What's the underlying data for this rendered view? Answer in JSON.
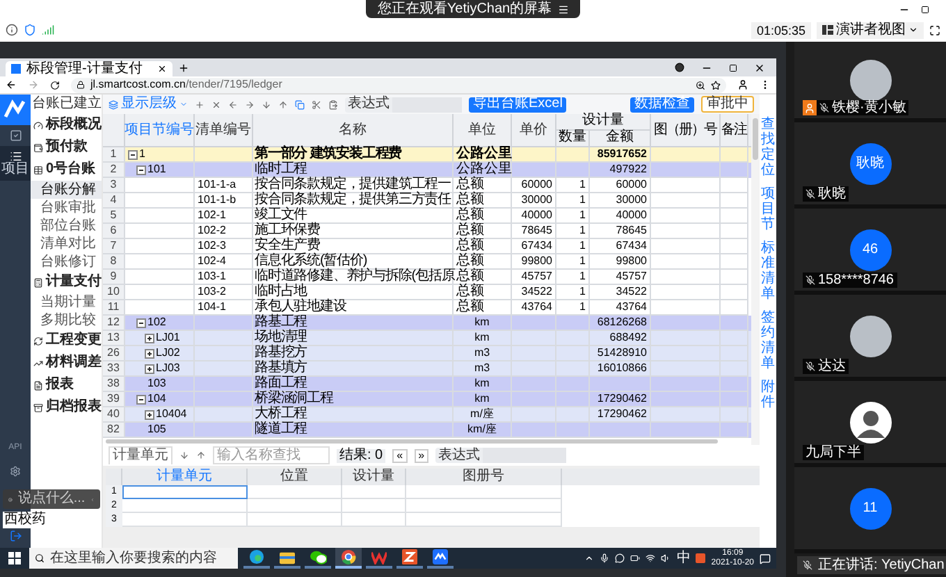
{
  "meeting": {
    "banner": "您正在观看YetiyChan的屏幕",
    "timer": "01:05:35",
    "view_button": "演讲者视图"
  },
  "browser": {
    "tab_title": "标段管理-计量支付",
    "url_host": "jl.smartcost.com.cn",
    "url_path": "/tender/7195/ledger"
  },
  "rail": {
    "items": [
      {
        "selected": false
      },
      {
        "label": "项目",
        "selected": true
      }
    ],
    "footer": "API",
    "tooltip": "西校药"
  },
  "chat": {
    "placeholder": "说点什么..."
  },
  "sidebar": {
    "status": "台账已建立",
    "groups": [
      {
        "label": "标段概况"
      },
      {
        "label": "预付款"
      },
      {
        "label": "0号台账",
        "items": [
          {
            "label": "台账分解",
            "selected": true
          },
          {
            "label": "台账审批",
            "selected": false
          },
          {
            "label": "部位台账",
            "selected": false
          },
          {
            "label": "清单对比",
            "selected": false
          },
          {
            "label": "台账修订",
            "selected": false
          }
        ]
      },
      {
        "label": "计量支付",
        "items": [
          {
            "label": "当期计量",
            "selected": false
          },
          {
            "label": "多期比较",
            "selected": false
          }
        ]
      },
      {
        "label": "工程变更"
      },
      {
        "label": "材料调差"
      },
      {
        "label": "报表"
      },
      {
        "label": "归档报表"
      }
    ]
  },
  "toolbar": {
    "level_button": "显示层级",
    "expression_label": "表达式",
    "export_button": "导出台账Excel",
    "check_button": "数据检查",
    "status_badge": "审批中"
  },
  "ledger": {
    "columns": [
      "项目节编号",
      "清单编号",
      "名称",
      "单位",
      "单价"
    ],
    "group": {
      "label": "设计量",
      "columns": [
        "数量",
        "金额"
      ]
    },
    "columns_after": [
      "图（册）号",
      "备注"
    ],
    "rows": [
      {
        "num": "1",
        "code": "1",
        "name": "第一部分 建筑安装工程费",
        "unit": "公路公里",
        "amount": "85917652",
        "expanded": true,
        "children": [
          {
            "num": "2",
            "code": "101",
            "name": "临时工程",
            "unit": "公路公里",
            "amount": "497922",
            "expanded": true,
            "children": [
              {
                "num": "3",
                "bill": "101-1-a",
                "name": "按合同条款规定，提供建筑工程一",
                "unit": "总额",
                "price": "60000",
                "qty": "1",
                "amount": "60000"
              },
              {
                "num": "4",
                "bill": "101-1-b",
                "name": "按合同条款规定，提供第三方责任",
                "unit": "总额",
                "price": "30000",
                "qty": "1",
                "amount": "30000"
              },
              {
                "num": "5",
                "bill": "102-1",
                "name": "竣工文件",
                "unit": "总额",
                "price": "40000",
                "qty": "1",
                "amount": "40000"
              },
              {
                "num": "6",
                "bill": "102-2",
                "name": "施工环保费",
                "unit": "总额",
                "price": "78645",
                "qty": "1",
                "amount": "78645"
              },
              {
                "num": "7",
                "bill": "102-3",
                "name": "安全生产费",
                "unit": "总额",
                "price": "67434",
                "qty": "1",
                "amount": "67434"
              },
              {
                "num": "8",
                "bill": "102-4",
                "name": "信息化系统(暂估价)",
                "unit": "总额",
                "price": "99800",
                "qty": "1",
                "amount": "99800"
              },
              {
                "num": "9",
                "bill": "103-1",
                "name": "临时道路修建、养护与拆除(包括原",
                "unit": "总额",
                "price": "45757",
                "qty": "1",
                "amount": "45757"
              },
              {
                "num": "10",
                "bill": "103-2",
                "name": "临时占地",
                "unit": "总额",
                "price": "34522",
                "qty": "1",
                "amount": "34522"
              },
              {
                "num": "11",
                "bill": "104-1",
                "name": "承包人驻地建设",
                "unit": "总额",
                "price": "43764",
                "qty": "1",
                "amount": "43764"
              }
            ]
          },
          {
            "num": "12",
            "code": "102",
            "name": "路基工程",
            "unit": "km",
            "amount": "68126268",
            "expanded": true,
            "children": [
              {
                "num": "13",
                "code": "LJ01",
                "name": "场地清理",
                "unit": "km",
                "amount": "688492",
                "expanded": false
              },
              {
                "num": "26",
                "code": "LJ02",
                "name": "路基挖方",
                "unit": "m3",
                "amount": "51428910",
                "expanded": false
              },
              {
                "num": "33",
                "code": "LJ03",
                "name": "路基填方",
                "unit": "m3",
                "amount": "16010866",
                "expanded": false
              }
            ]
          },
          {
            "num": "38",
            "code": "103",
            "name": "路面工程",
            "unit": "km"
          },
          {
            "num": "39",
            "code": "104",
            "name": "桥梁涵洞工程",
            "unit": "km",
            "amount": "17290462",
            "expanded": true,
            "children": [
              {
                "num": "40",
                "code": "10404",
                "name": "大桥工程",
                "unit": "m/座",
                "amount": "17290462",
                "expanded": false
              }
            ]
          },
          {
            "num": "82",
            "code": "105",
            "name": "隧道工程",
            "unit": "km/座"
          }
        ]
      }
    ]
  },
  "side_links": [
    "查找定位",
    "项目节",
    "标准清单",
    "签约清单",
    "附件"
  ],
  "units": {
    "tab": "计量单元",
    "search_placeholder": "输入名称查找",
    "result": "结果: 0",
    "prev": "«",
    "next": "»",
    "expression_label": "表达式",
    "columns": [
      "计量单元",
      "位置",
      "设计量",
      "图册号"
    ],
    "rows": [
      "1",
      "2",
      "3"
    ]
  },
  "taskbar": {
    "search_placeholder": "在这里输入你要搜索的内容",
    "apps": [
      {
        "kind": "edge",
        "selected": false
      },
      {
        "kind": "folder",
        "selected": false
      },
      {
        "kind": "wechat",
        "selected": false
      },
      {
        "kind": "chrome",
        "selected": true
      },
      {
        "kind": "wps",
        "selected": false
      },
      {
        "kind": "zapp",
        "selected": false
      },
      {
        "kind": "meeting",
        "selected": false
      }
    ],
    "ime": "中",
    "time": "16:09",
    "date": "2021-10-20"
  },
  "participants": [
    {
      "name": "铁樱·黄小敏",
      "kind": "photo",
      "muted": true,
      "host": true
    },
    {
      "name": "耿晓",
      "kind": "initials",
      "avatar_text": "耿晓",
      "muted": true,
      "host": false
    },
    {
      "name": "158****8746",
      "kind": "initials",
      "avatar_text": "46",
      "muted": true,
      "host": false
    },
    {
      "name": "达达",
      "kind": "photo",
      "muted": true,
      "host": false
    },
    {
      "name": "九局下半",
      "kind": "cartoon",
      "muted": false,
      "host": false
    },
    {
      "kind": "initials",
      "avatar_text": "11",
      "muted": false,
      "host": false
    }
  ],
  "speaking": "正在讲话: YetiyChan"
}
